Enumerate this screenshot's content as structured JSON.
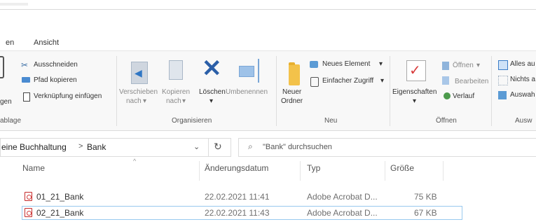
{
  "window": {
    "tabs": [
      "en",
      "Ansicht"
    ]
  },
  "ribbon": {
    "clipboard": {
      "cut": "Ausschneiden",
      "copy_path": "Pfad kopieren",
      "paste_shortcut": "Verknüpfung einfügen",
      "paste_partial": "gen",
      "group": "ablage"
    },
    "organize": {
      "move_1": "Verschieben",
      "move_2": "nach",
      "copy_1": "Kopieren",
      "copy_2": "nach",
      "delete": "Löschen",
      "rename": "Umbenennen",
      "group": "Organisieren"
    },
    "new": {
      "new_folder_1": "Neuer",
      "new_folder_2": "Ordner",
      "new_item": "Neues Element",
      "easy_access": "Einfacher Zugriff",
      "group": "Neu"
    },
    "open": {
      "properties": "Eigenschaften",
      "open": "Öffnen",
      "edit": "Bearbeiten",
      "history": "Verlauf",
      "group": "Öffnen"
    },
    "select": {
      "select_all": "Alles au",
      "select_none": "Nichts a",
      "invert": "Auswah",
      "group": "Ausw"
    }
  },
  "address": {
    "path_parent": "eine Buchhaltung",
    "separator": ">",
    "path_current": "Bank",
    "search_placeholder": "\"Bank\" durchsuchen"
  },
  "columns": {
    "name": "Name",
    "date": "Änderungsdatum",
    "type": "Typ",
    "size": "Größe"
  },
  "files": [
    {
      "name": "01_21_Bank",
      "date": "22.02.2021 11:41",
      "type": "Adobe Acrobat D...",
      "size": "75 KB"
    },
    {
      "name": "02_21_Bank",
      "date": "22.02.2021 11:43",
      "type": "Adobe Acrobat D...",
      "size": "67 KB"
    }
  ]
}
